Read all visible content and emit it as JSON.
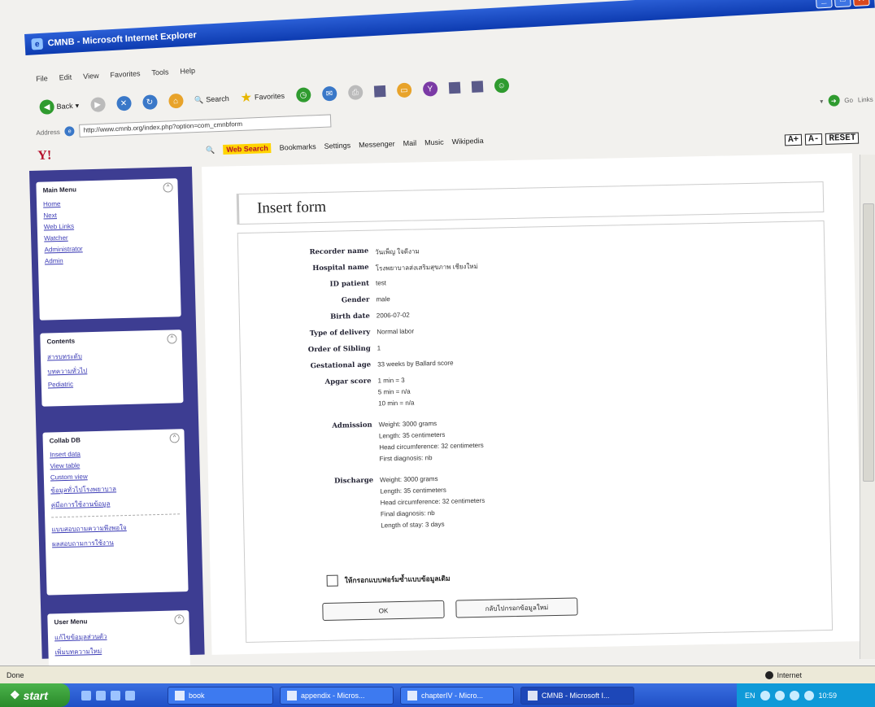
{
  "window": {
    "title": "CMNB - Microsoft Internet Explorer"
  },
  "menu": [
    "File",
    "Edit",
    "View",
    "Favorites",
    "Tools",
    "Help"
  ],
  "toolbar": {
    "back": "Back",
    "search": "Search",
    "favorites": "Favorites"
  },
  "address": {
    "label": "Address",
    "url": "http://www.cmnb.org/index.php?option=com_cmnbform",
    "go": "Go",
    "links": "Links"
  },
  "yahoo": {
    "logo": "Y!",
    "web_search": "Web Search",
    "bookmarks": "Bookmarks",
    "settings": "Settings",
    "messenger": "Messenger",
    "mail": "Mail",
    "music": "Music",
    "wikipedia": "Wikipedia"
  },
  "text_size": [
    "A+",
    "A-",
    "RESET"
  ],
  "sidebar": {
    "main_menu": {
      "title": "Main Menu",
      "items": [
        "Home",
        "Next",
        "Web Links",
        "Watcher",
        "Administrator",
        "Admin"
      ]
    },
    "contents": {
      "title": "Contents",
      "items": [
        "สารบทระดับ",
        "บทความทั่วไป",
        "Pediatric"
      ]
    },
    "collab": {
      "title": "Collab DB",
      "items": [
        "Insert data",
        "View table",
        "Custom view",
        "ข้อมูลทั่วไปโรงพยาบาล",
        "คู่มือการใช้งานข้อมูล"
      ],
      "items2": [
        "แบบสอบถามความพึงพอใจ",
        "ผลสอบถามการใช้งาน"
      ]
    },
    "user_menu": {
      "title": "User Menu",
      "items": [
        "แก้ไขข้อมูลส่วนตัว",
        "เพิ่มบทความใหม่"
      ]
    }
  },
  "form": {
    "title": "Insert form",
    "fields": {
      "recorder_name": {
        "label": "Recorder name",
        "value": "วันเพ็ญ ใจดีงาม"
      },
      "hospital_name": {
        "label": "Hospital name",
        "value": "โรงพยาบาลส่งเสริมสุขภาพ เชียงใหม่"
      },
      "id_patient": {
        "label": "ID patient",
        "value": "test"
      },
      "gender": {
        "label": "Gender",
        "value": "male"
      },
      "birth_date": {
        "label": "Birth date",
        "value": "2006-07-02"
      },
      "type_of_delivery": {
        "label": "Type of delivery",
        "value": "Normal labor"
      },
      "order_of_sibling": {
        "label": "Order of Sibling",
        "value": "1"
      },
      "gestational_age": {
        "label": "Gestational age",
        "value": "33 weeks by Ballard score"
      },
      "apgar_score": {
        "label": "Apgar score",
        "lines": [
          "1 min = 3",
          "5 min = n/a",
          "10 min = n/a"
        ]
      },
      "admission": {
        "label": "Admission",
        "lines": [
          "Weight: 3000 grams",
          "Length: 35 centimeters",
          "Head circumference: 32 centimeters",
          "First diagnosis: nb"
        ]
      },
      "discharge": {
        "label": "Discharge",
        "lines": [
          "Weight: 3000 grams",
          "Length: 35 centimeters",
          "Head circumference: 32 centimeters",
          "Final diagnosis: nb",
          "Length of stay: 3 days"
        ]
      }
    },
    "checkbox_label": "ให้กรอกแบบฟอร์มซ้ำแบบข้อมูลเดิม",
    "ok_button": "OK",
    "back_button": "กลับไปกรอกข้อมูลใหม่"
  },
  "status": {
    "left": "Done",
    "zone": "Internet"
  },
  "taskbar": {
    "start": "start",
    "tasks": [
      "book",
      "appendix - Micros...",
      "chapterIV - Micro...",
      "CMNB - Microsoft I..."
    ],
    "lang": "EN",
    "clock": "10:59"
  }
}
